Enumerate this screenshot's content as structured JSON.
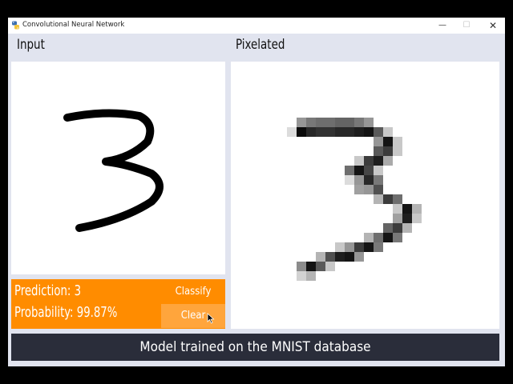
{
  "window": {
    "title": "Convolutional Neural Network",
    "controls": {
      "minimize": "—",
      "maximize": "☐",
      "close": "✕"
    }
  },
  "panels": {
    "input_label": "Input",
    "pixelated_label": "Pixelated"
  },
  "results": {
    "prediction": "Prediction: 3",
    "probability": "Probability: 99.87%"
  },
  "buttons": {
    "classify": "Classify",
    "clear": "Clear"
  },
  "footer": {
    "text": "Model trained on the MNIST database"
  },
  "colors": {
    "accent": "#ff8c00",
    "accent_light": "#ffa53c",
    "footer_bg": "#2a2d3a",
    "window_bg": "#e1e4ef"
  },
  "icons": [
    "python-app-icon",
    "cursor-arrow-icon"
  ]
}
